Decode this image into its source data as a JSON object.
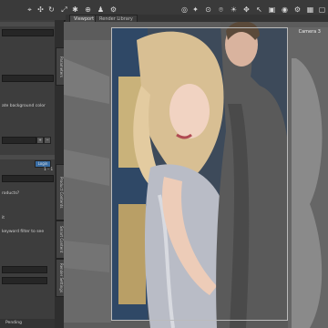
{
  "toolbar": {
    "icons": [
      "select-icon",
      "move-icon",
      "rotate-icon",
      "scale-icon",
      "node-icon",
      "universal-icon",
      "pose-icon",
      "joint-icon",
      "camera-icon",
      "light-icon",
      "render-icon",
      "snapshot-icon",
      "settings-icon"
    ]
  },
  "tabs": {
    "viewport": "Viewport",
    "render_library": "Render Library"
  },
  "left_pane": {
    "line_1": "ate background color",
    "line_2": "",
    "stepper_value": "",
    "login_label": "Login",
    "page_indicator": "1 - 1",
    "question": "roducts?",
    "hint_1": "it",
    "hint_2": "keyword filter to see"
  },
  "side_tabs": [
    "Parameters",
    "Product Contents",
    "Smart Content",
    "Render Settings"
  ],
  "viewport": {
    "camera_label": "Camera 3"
  },
  "status": {
    "bottom_label": "Pending"
  }
}
